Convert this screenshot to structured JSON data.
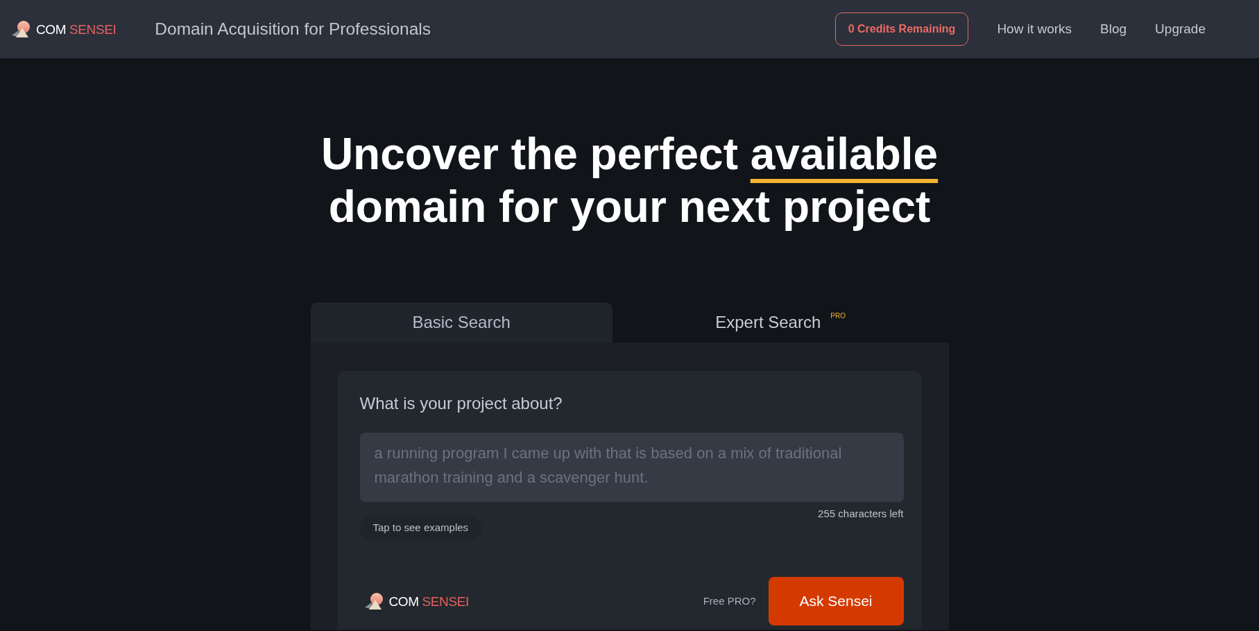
{
  "header": {
    "logo": {
      "words": [
        {
          "text": "COM",
          "accent": false
        },
        {
          "text": "SENSEI",
          "accent": true
        }
      ]
    },
    "tagline": "Domain Acquisition for Professionals",
    "credits_button": "0 Credits Remaining",
    "nav_links": [
      "How it works",
      "Blog",
      "Upgrade"
    ]
  },
  "hero": {
    "headline": [
      {
        "text": "Uncover the perfect ",
        "underlined": false
      },
      {
        "text": "available",
        "underlined": true
      },
      {
        "text": " domain for your next project",
        "underlined": false
      }
    ]
  },
  "search_panel": {
    "tabs": [
      {
        "label": "Basic Search",
        "selected": true
      },
      {
        "label": "Expert Search",
        "selected": false,
        "tag": "PRO"
      }
    ],
    "question": "What is your project about?",
    "description_field": {
      "placeholder": "a running program I came up with that is based on a mix of traditional marathon training and a scavenger hunt."
    },
    "characters_left": "255 characters left",
    "examples_button": "Tap to see examples",
    "footer": {
      "logo": {
        "words": [
          {
            "text": "COM",
            "accent": false
          },
          {
            "text": "SENSEI",
            "accent": true
          }
        ]
      },
      "free_pro_link": "Free PRO?",
      "submit_button": "Ask Sensei"
    }
  }
}
